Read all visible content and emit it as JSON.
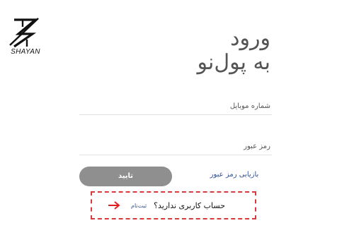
{
  "logo": {
    "text": "SHAYAN"
  },
  "headline": {
    "line1": "ورود",
    "line2": "به پول‌نو"
  },
  "form": {
    "mobile_placeholder": "شماره موبایل",
    "password_placeholder": "رمز عبور",
    "submit_label": "تایید",
    "forgot_label": "بازیابی رمز عبور"
  },
  "signup": {
    "question": "حساب کاربری ندارید؟",
    "link_label": "ثبت‌نام",
    "arrow_icon": "arrow-right-icon"
  },
  "colors": {
    "button_bg": "#8f8f8f",
    "link": "#2e4f97",
    "highlight_border": "#d63a3a",
    "arrow": "#e11f1f"
  }
}
